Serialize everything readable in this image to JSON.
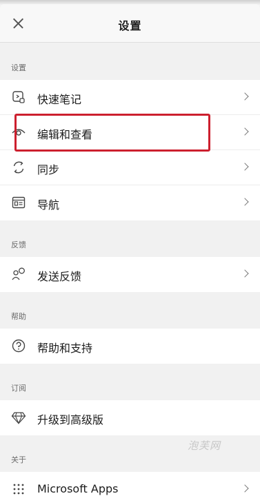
{
  "header": {
    "title": "设置",
    "close_icon": "close-icon"
  },
  "sections": [
    {
      "label": "设置",
      "items": [
        {
          "label": "快速笔记",
          "icon": "quick-note-icon"
        },
        {
          "label": "编辑和查看",
          "icon": "eye-icon"
        },
        {
          "label": "同步",
          "icon": "sync-icon"
        },
        {
          "label": "导航",
          "icon": "navigation-icon"
        }
      ]
    },
    {
      "label": "反馈",
      "items": [
        {
          "label": "发送反馈",
          "icon": "feedback-icon"
        }
      ]
    },
    {
      "label": "帮助",
      "items": [
        {
          "label": "帮助和支持",
          "icon": "help-icon"
        }
      ]
    },
    {
      "label": "订阅",
      "items": [
        {
          "label": "升级到高级版",
          "icon": "diamond-icon"
        }
      ]
    },
    {
      "label": "关于",
      "items": [
        {
          "label": "Microsoft Apps",
          "icon": "apps-grid-icon"
        }
      ]
    }
  ],
  "watermark": "泡芙网",
  "colors": {
    "highlight": "#cc1f2e",
    "background": "#f1f1f1",
    "row": "#ffffff"
  }
}
